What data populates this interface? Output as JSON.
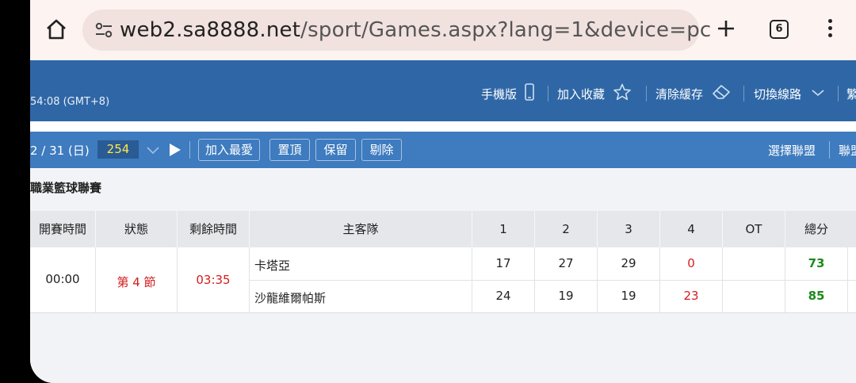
{
  "browser": {
    "url_host": "web2.sa8888.net",
    "url_path": "/sport/Games.aspx?lang=1&device=pc",
    "tab_count": "6"
  },
  "header": {
    "clock": "54:08 (GMT+8)",
    "mobile_label": "手機版",
    "favorite_label": "加入收藏",
    "clear_cache_label": "清除緩存",
    "switch_line_label": "切換線路",
    "extra_label": "繁"
  },
  "toolbar": {
    "date": "2 / 31 (日)",
    "count": "254",
    "buttons": [
      "加入最愛",
      "置頂",
      "保留",
      "剔除"
    ],
    "select_league": "選擇聯盟",
    "extra": "聯盟"
  },
  "league": {
    "title": "職業籃球聯賽"
  },
  "table": {
    "headers": [
      "開賽時間",
      "狀態",
      "剩餘時間",
      "主客隊",
      "1",
      "2",
      "3",
      "4",
      "OT",
      "總分"
    ],
    "game": {
      "start_time": "00:00",
      "status": "第 4 節",
      "remaining": "03:35",
      "teams": [
        {
          "name": "卡塔亞",
          "q1": "17",
          "q2": "27",
          "q3": "29",
          "q4": "0",
          "ot": "",
          "total": "73"
        },
        {
          "name": "沙龍維爾帕斯",
          "q1": "24",
          "q2": "19",
          "q3": "19",
          "q4": "23",
          "ot": "",
          "total": "85"
        }
      ]
    }
  }
}
